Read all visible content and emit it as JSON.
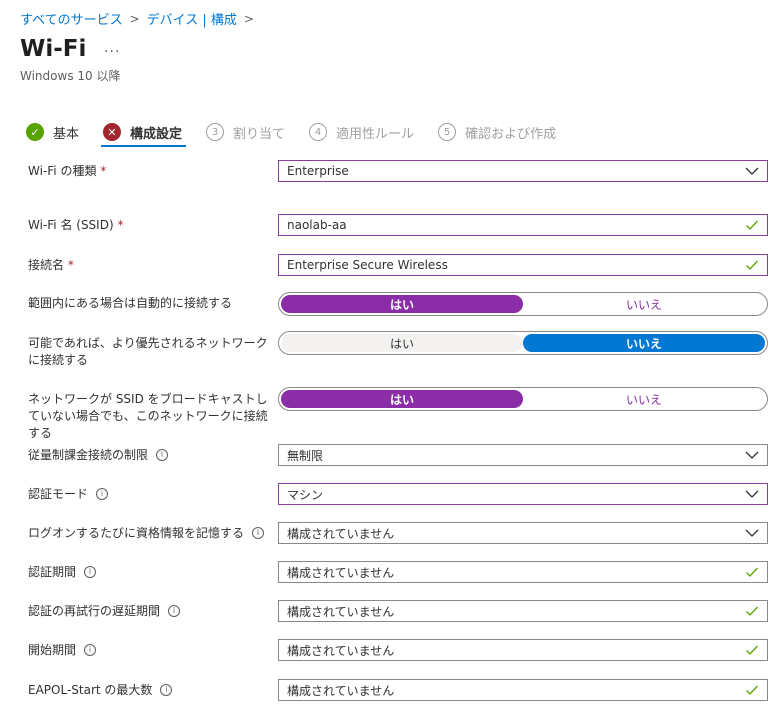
{
  "breadcrumb": {
    "items": [
      "すべてのサービス",
      "デバイス | 構成"
    ]
  },
  "header": {
    "title": "Wi-Fi",
    "more": "...",
    "subtitle": "Windows 10 以降"
  },
  "steps": [
    {
      "label": "基本",
      "number": "",
      "state": "done"
    },
    {
      "label": "構成設定",
      "number": "",
      "state": "active"
    },
    {
      "label": "割り当て",
      "number": "3",
      "state": "inactive"
    },
    {
      "label": "適用性ルール",
      "number": "4",
      "state": "inactive"
    },
    {
      "label": "確認および作成",
      "number": "5",
      "state": "inactive"
    }
  ],
  "form": {
    "wifi_type": {
      "label": "Wi-Fi の種類",
      "required": "*",
      "value": "Enterprise"
    },
    "ssid": {
      "label": "Wi-Fi 名 (SSID)",
      "required": "*",
      "value": "naolab-aa"
    },
    "connection_name": {
      "label": "接続名",
      "required": "*",
      "value": "Enterprise Secure Wireless"
    },
    "auto_connect": {
      "label": "範囲内にある場合は自動的に接続する",
      "yes": "はい",
      "no": "いいえ"
    },
    "prefer_network": {
      "label": "可能であれば、より優先されるネットワークに接続する",
      "yes": "はい",
      "no": "いいえ"
    },
    "hidden_ssid": {
      "label": "ネットワークが SSID をブロードキャストしていない場合でも、このネットワークに接続する",
      "yes": "はい",
      "no": "いいえ"
    },
    "metered": {
      "label": "従量制課金接続の制限",
      "value": "無制限"
    },
    "auth_mode": {
      "label": "認証モード",
      "value": "マシン"
    },
    "remember_creds": {
      "label": "ログオンするたびに資格情報を記憶する",
      "value": "構成されていません"
    },
    "auth_period": {
      "label": "認証期間",
      "value": "構成されていません"
    },
    "auth_retry": {
      "label": "認証の再試行の遅延期間",
      "value": "構成されていません"
    },
    "start_period": {
      "label": "開始期間",
      "value": "構成されていません"
    },
    "eapol_max": {
      "label": "EAPOL-Start の最大数",
      "value": "構成されていません"
    }
  },
  "colors": {
    "accent": "#0078d4",
    "purple": "#8a2da6",
    "success": "#57a300",
    "error": "#a4262c"
  }
}
